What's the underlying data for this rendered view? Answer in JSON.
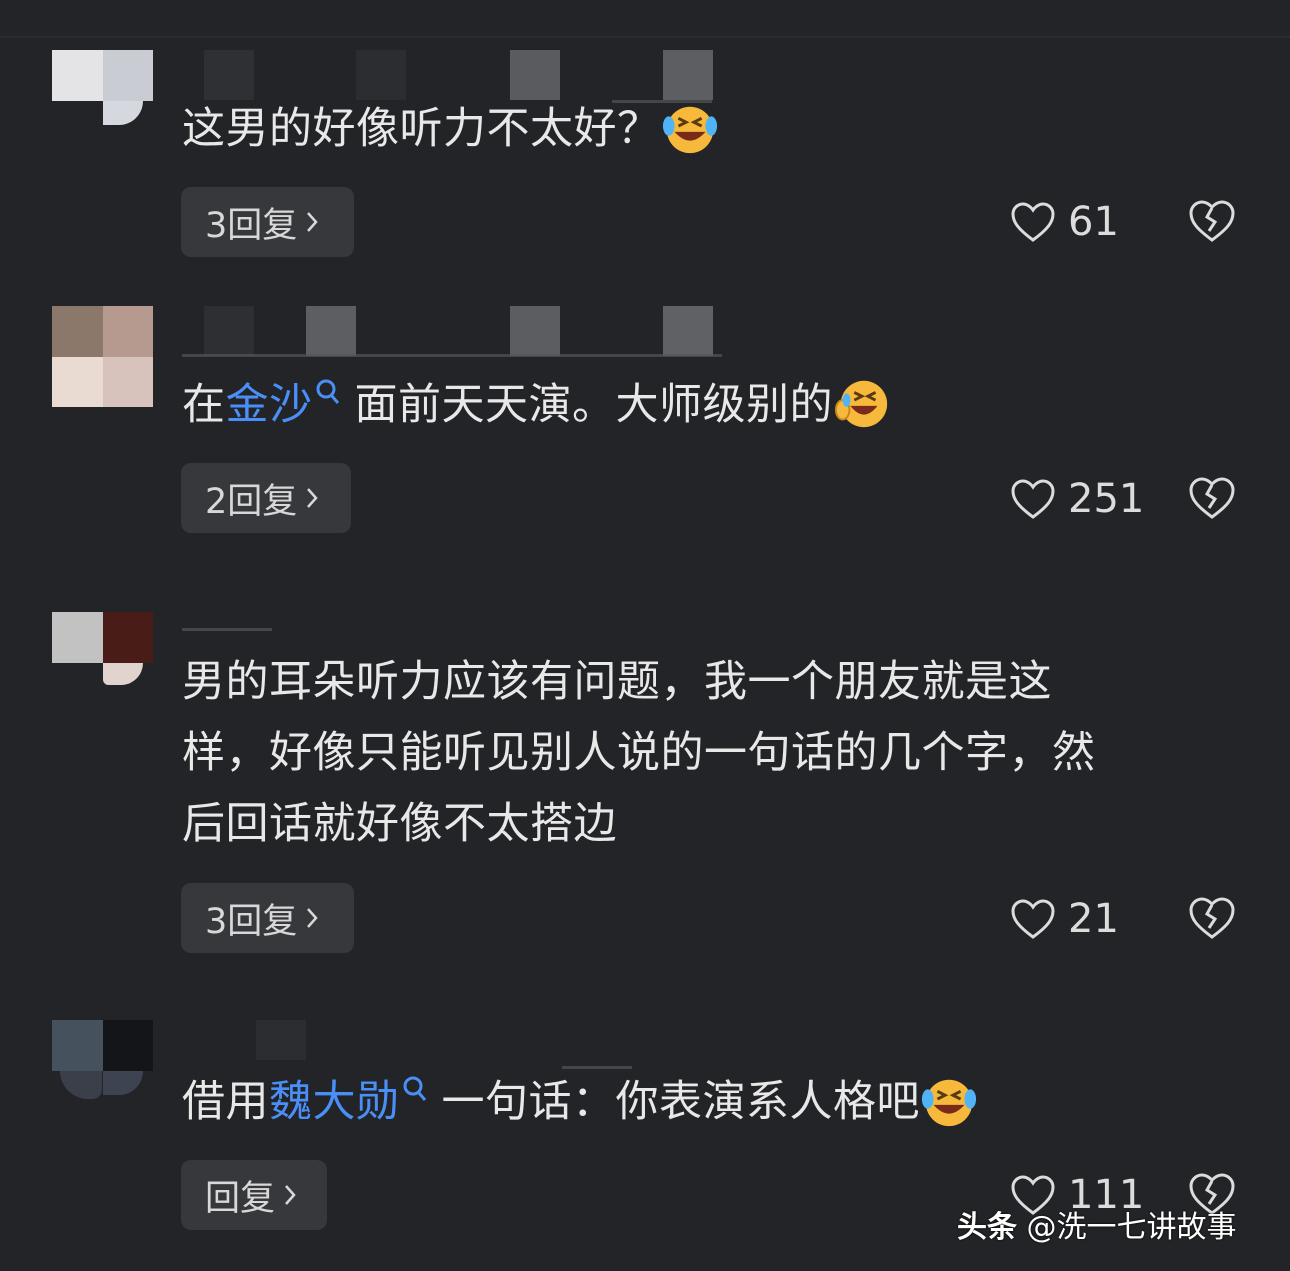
{
  "comments": [
    {
      "text": "这男的好像听力不太好？",
      "reply_label": "3回复",
      "likes": "61"
    },
    {
      "text_before": "在",
      "link": "金沙",
      "text_after": "面前天天演。大师级别的",
      "reply_label": "2回复",
      "likes": "251"
    },
    {
      "line1": "男的耳朵听力应该有问题，我一个朋友就是这",
      "line2": "样，好像只能听见别人说的一句话的几个字，然",
      "line3": "后回话就好像不太搭边",
      "reply_label": "3回复",
      "likes": "21"
    },
    {
      "text_before": "借用",
      "link": "魏大勋",
      "text_after": "一句话：你表演系人格吧",
      "reply_label": "回复",
      "likes": "111"
    }
  ],
  "watermark": {
    "brand": "头条",
    "handle": "@洗一七讲故事"
  },
  "colors": {
    "background": "#232427",
    "link": "#4a8ff7",
    "reply_button": "#37383c"
  },
  "icons": [
    "heart-icon",
    "broken-heart-icon",
    "search-icon",
    "laughing-emoji-icon",
    "chevron-right-icon"
  ]
}
